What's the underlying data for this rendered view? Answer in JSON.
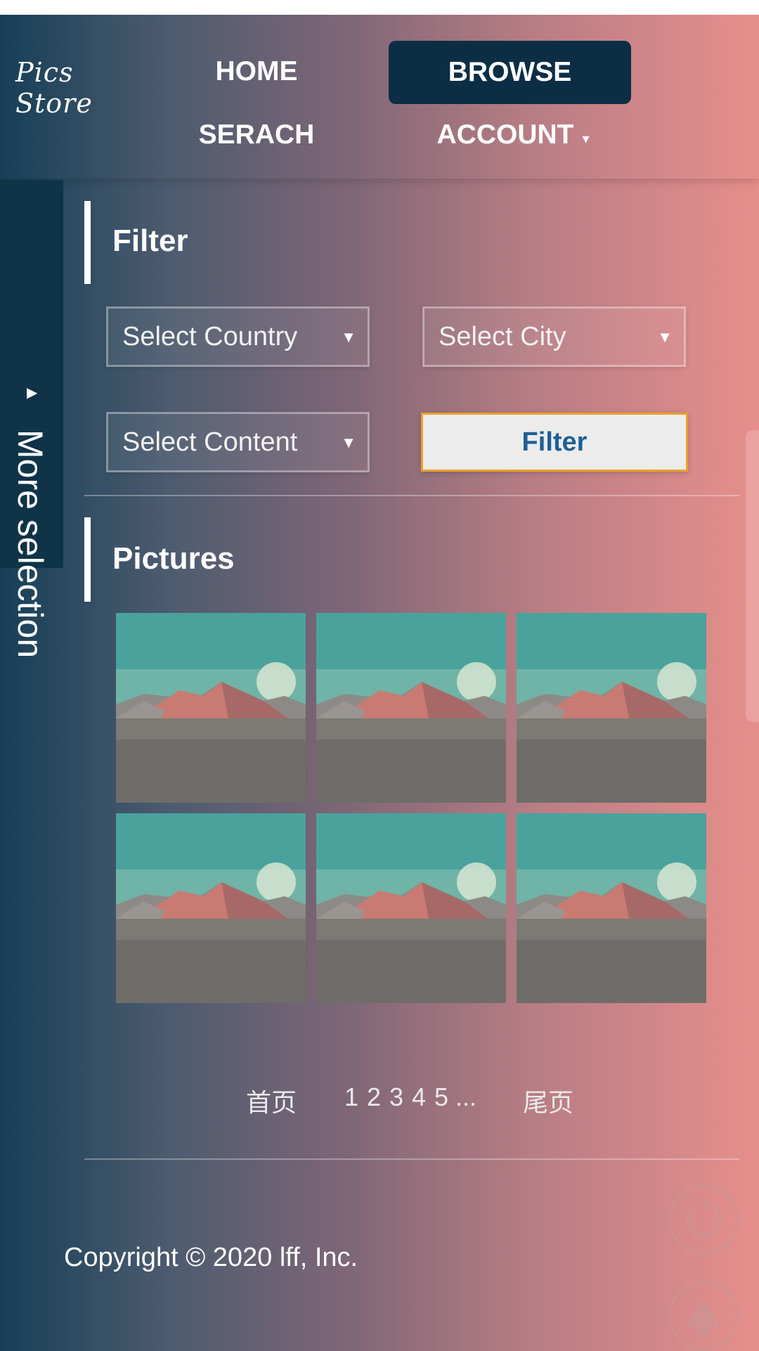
{
  "app": {
    "logo": "Pics Store"
  },
  "nav": {
    "home": "HOME",
    "browse": "BROWSE",
    "search": "SERACH",
    "account": "ACCOUNT",
    "account_caret": "▾"
  },
  "sidebar": {
    "label": "More selection",
    "arrow": "▶"
  },
  "filter": {
    "title": "Filter",
    "country": "Select Country",
    "city": "Select City",
    "content": "Select Content",
    "arrow": "▼",
    "button": "Filter"
  },
  "pictures": {
    "title": "Pictures",
    "count": 6
  },
  "pagination": {
    "first": "首页",
    "pages": [
      "1",
      "2",
      "3",
      "4",
      "5",
      "..."
    ],
    "last": "尾页"
  },
  "footer": {
    "copyright": "Copyright © 2020 lff, Inc."
  },
  "colors": {
    "header_selected": "#0c2e45",
    "sidebar": "#0f3347",
    "filter_button_border": "#e9a32a",
    "filter_button_text": "#1f5f93"
  },
  "icons": {
    "sidebar_arrow": "triangle-right-icon",
    "select_arrow": "triangle-down-icon",
    "refresh": "refresh-icon",
    "back_to_top": "arrow-up-icon"
  }
}
